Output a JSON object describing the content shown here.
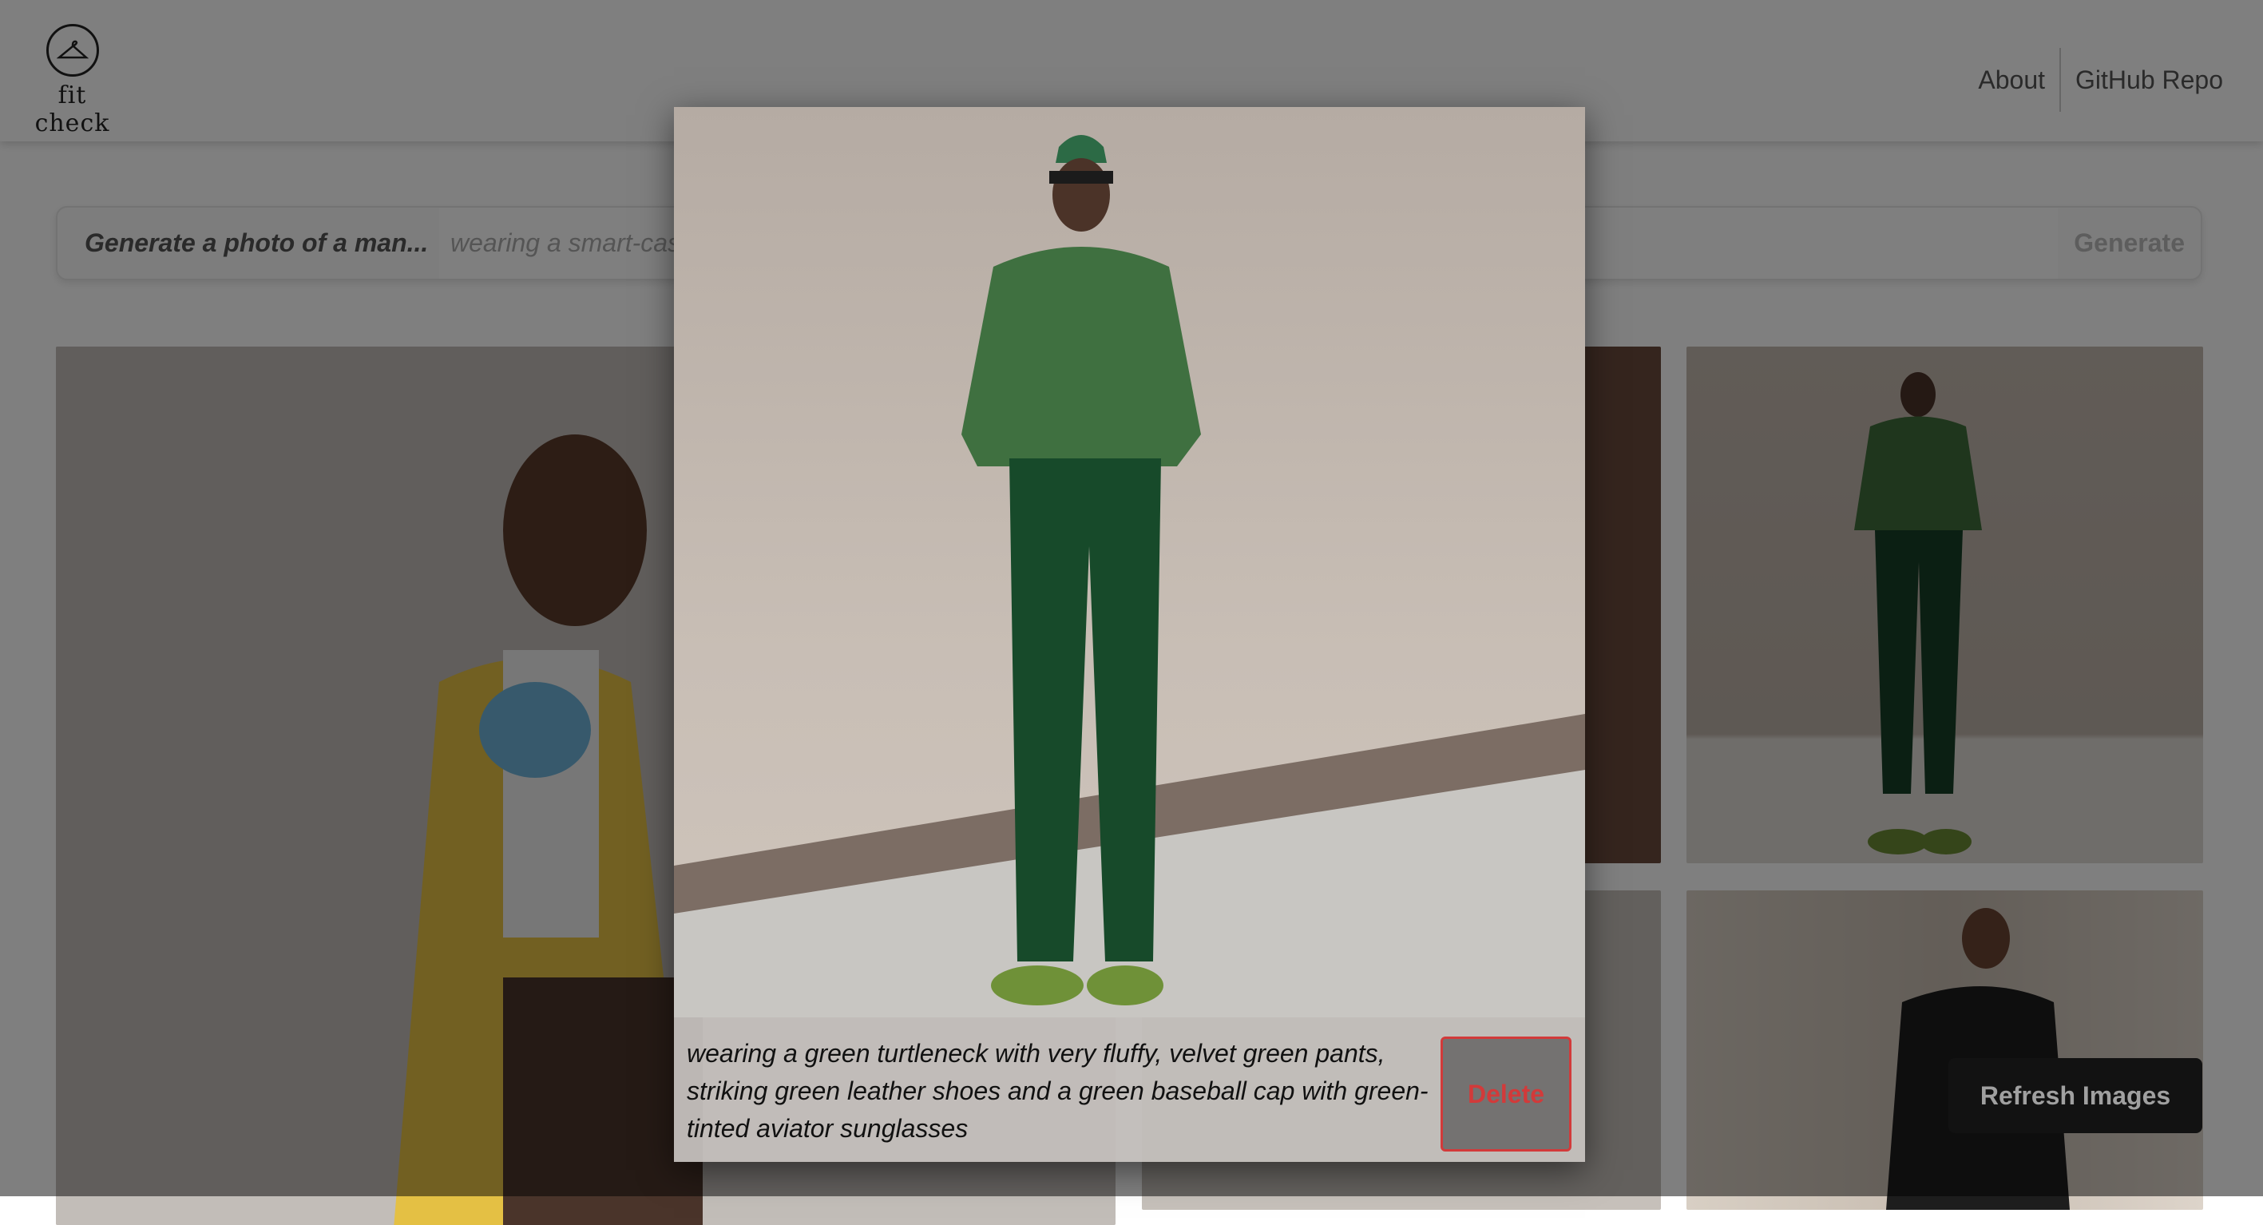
{
  "header": {
    "logo_text": "fit check",
    "logo_icon": "hanger-icon",
    "nav": [
      {
        "label": "About"
      },
      {
        "label": "GitHub Repo"
      }
    ]
  },
  "prompt": {
    "label": "Generate a photo of a man...",
    "placeholder": "wearing a smart-casual outfit",
    "value": "",
    "generate_label": "Generate"
  },
  "modal": {
    "caption": "wearing a green turtleneck with very fluffy, velvet green pants, striking green leather shoes and a green baseball cap with green-tinted aviator sunglasses",
    "delete_label": "Delete",
    "delete_color": "#d23a3a"
  },
  "refresh_label": "Refresh Images",
  "colors": {
    "overlay": "rgba(0,0,0,0.5)",
    "outfit_green": "#2f6a3a"
  }
}
